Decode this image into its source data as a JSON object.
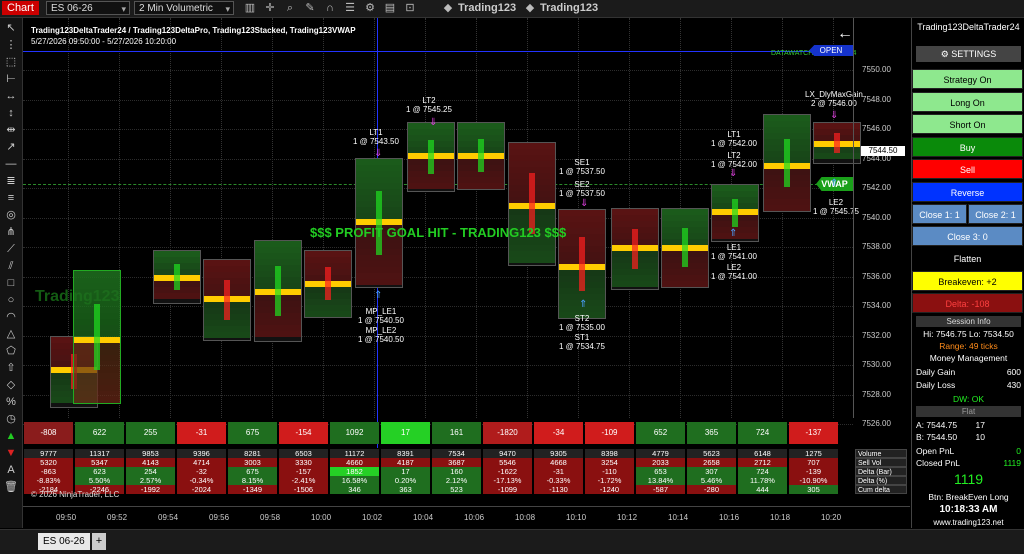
{
  "toolbar": {
    "chart_tab": "Chart",
    "instrument": "ES 06-26",
    "interval": "2 Min Volumetric",
    "label1": "Trading123",
    "label2": "Trading123"
  },
  "chart": {
    "title": "Trading123DeltaTrader24 / Trading123DeltaPro, Trading123Stacked, Trading123VWAP",
    "range": "5/27/2026 09:50:00 - 5/27/2026 10:20:00",
    "watermark": "Trading123",
    "profit_banner": "$$$ PROFIT GOAL HIT - TRADING123 $$$",
    "datawatch": "DATAWATCH: OK 10:18:34",
    "open_tag": "OPEN",
    "price_tag": "7544.50",
    "vwap_tag": "VWAP",
    "copyright": "© 2026 NinjaTrader, LLC",
    "y_labels": [
      "7550.00",
      "7548.00",
      "7546.00",
      "7544.00",
      "7542.00",
      "7540.00",
      "7538.00",
      "7536.00",
      "7534.00",
      "7532.00",
      "7530.00",
      "7528.00",
      "7526.00"
    ],
    "x_labels": [
      "09:50",
      "09:52",
      "09:54",
      "09:56",
      "09:58",
      "10:00",
      "10:02",
      "10:04",
      "10:06",
      "10:08",
      "10:10",
      "10:12",
      "10:14",
      "10:16",
      "10:18",
      "10:20"
    ],
    "annotations": [
      {
        "text": "LT2",
        "sub": "1 @ 7545.25"
      },
      {
        "text": "LT1",
        "sub": "1 @ 7543.50"
      },
      {
        "text": "SE1",
        "sub": "1 @ 7537.50"
      },
      {
        "text": "SE2",
        "sub": "1 @ 7537.50"
      },
      {
        "text": "MP_LE1",
        "sub": "1 @ 7540.50"
      },
      {
        "text": "MP_LE2",
        "sub": "1 @ 7540.50"
      },
      {
        "text": "ST2",
        "sub": "1 @ 7535.00"
      },
      {
        "text": "ST1",
        "sub": "1 @ 7534.75"
      },
      {
        "text": "LT1",
        "sub": "1 @ 7542.00"
      },
      {
        "text": "LT2",
        "sub": "1 @ 7542.00"
      },
      {
        "text": "LE1",
        "sub": "1 @ 7541.00"
      },
      {
        "text": "LE2",
        "sub": "1 @ 7541.00"
      },
      {
        "text": "LX_DlyMaxGain",
        "sub": "2 @ 7546.00"
      },
      {
        "text": "LE2",
        "sub": "1 @ 7545.75"
      }
    ],
    "bar_deltas": [
      "-808",
      "622",
      "255",
      "-31",
      "675",
      "-154",
      "1092",
      "17",
      "161",
      "-1820",
      "-34",
      "-109",
      "652",
      "365",
      "724",
      "-137"
    ],
    "bar_delta_colors": [
      "#8a1c1c",
      "#1f6e1f",
      "#1f6e1f",
      "#d01c1c",
      "#1f6e1f",
      "#d01c1c",
      "#1f6e1f",
      "#25d025",
      "#1f6e1f",
      "#b01c1c",
      "#d01c1c",
      "#d01c1c",
      "#1f6e1f",
      "#1f6e1f",
      "#1f6e1f",
      "#d01c1c"
    ],
    "stats": {
      "labels": [
        "Volume",
        "Sell Vol",
        "Delta (Bar)",
        "Delta (%)",
        "Cum delta"
      ],
      "volume": [
        "9777",
        "11317",
        "9853",
        "9396",
        "8281",
        "6503",
        "11172",
        "8391",
        "7534",
        "9470",
        "9305",
        "8398",
        "4779",
        "5623",
        "6148",
        "1275"
      ],
      "sell_vol": [
        "5320",
        "5347",
        "4143",
        "4714",
        "3003",
        "3330",
        "4660",
        "4187",
        "3687",
        "5546",
        "4668",
        "3254",
        "2033",
        "2658",
        "2712",
        "707"
      ],
      "delta_bar": [
        "-863",
        "623",
        "254",
        "-32",
        "675",
        "-157",
        "1852",
        "17",
        "160",
        "-1622",
        "-31",
        "-110",
        "653",
        "307",
        "724",
        "-139"
      ],
      "delta_pct": [
        "-8.83%",
        "5.50%",
        "2.57%",
        "-0.34%",
        "8.15%",
        "-2.41%",
        "16.58%",
        "0.20%",
        "2.12%",
        "-17.13%",
        "-0.33%",
        "-1.72%",
        "13.84%",
        "5.46%",
        "11.78%",
        "-10.90%"
      ],
      "cum_delta": [
        "-2184",
        "-2246",
        "-1992",
        "-2024",
        "-1349",
        "-1506",
        "346",
        "363",
        "523",
        "-1099",
        "-1130",
        "-1240",
        "-587",
        "-280",
        "444",
        "305"
      ]
    }
  },
  "panel": {
    "title": "Trading123DeltaTrader24",
    "settings": "SETTINGS",
    "buttons": [
      {
        "label": "Strategy On",
        "bg": "#8ee88e",
        "fg": "#000"
      },
      {
        "label": "Long On",
        "bg": "#8ee88e",
        "fg": "#000"
      },
      {
        "label": "Short On",
        "bg": "#8ee88e",
        "fg": "#000"
      },
      {
        "label": "Buy",
        "bg": "#0a8a0a",
        "fg": "#fff"
      },
      {
        "label": "Sell",
        "bg": "#ff0000",
        "fg": "#fff"
      },
      {
        "label": "Reverse",
        "bg": "#0033ff",
        "fg": "#fff"
      }
    ],
    "close1": "Close 1: 1",
    "close2": "Close 2: 1",
    "close3": "Close 3: 0",
    "flatten": "Flatten",
    "breakeven": "Breakeven: +2",
    "delta": "Delta: -108",
    "session_hdr": "Session Info",
    "hi_lo": "Hi: 7546.75    Lo: 7534.50",
    "range": "Range: 49 ticks",
    "money_hdr": "Money Management",
    "daily_gain": {
      "k": "Daily Gain",
      "v": "600"
    },
    "daily_loss": {
      "k": "Daily Loss",
      "v": "430"
    },
    "dw": "DW: OK",
    "flat": "Flat",
    "pos_a": {
      "k": "A: 7544.75",
      "v": "17"
    },
    "pos_b": {
      "k": "B: 7544.50",
      "v": "10"
    },
    "open_pnl": {
      "k": "Open PnL",
      "v": "0"
    },
    "closed_pnl": {
      "k": "Closed PnL",
      "v": "1119"
    },
    "big_pnl": "1119",
    "btn_mode": "Btn: BreakEven Long",
    "time": "10:18:33 AM",
    "website": "www.trading123.net"
  },
  "bottom": {
    "tab": "ES 06-26",
    "add": "+"
  }
}
